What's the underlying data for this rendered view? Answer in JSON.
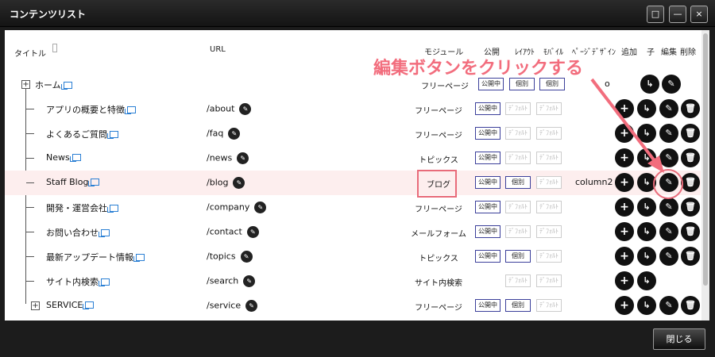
{
  "window": {
    "title": "コンテンツリスト",
    "maximize_icon": "□",
    "minimize_icon": "—",
    "close_icon": "×"
  },
  "headers": {
    "title": "タイトル",
    "url": "URL",
    "module": "モジュール",
    "publish": "公開",
    "layout": "ﾚｲｱｳﾄ",
    "mobile": "ﾓﾊﾞｲﾙ",
    "page_design": "ﾍﾟｰｼﾞﾃﾞｻﾞｲﾝ",
    "add": "追加",
    "child": "子",
    "edit": "編集",
    "delete": "削除"
  },
  "annotation": "編集ボタンをクリックする",
  "rows": [
    {
      "name": "ホーム",
      "url": "",
      "module": "フリーページ",
      "publish": "公開中",
      "layout": "個別",
      "mobile": "個別",
      "page_design": "o"
    },
    {
      "name": "アプリの概要と特徴",
      "url": "/about",
      "module": "フリーページ",
      "publish": "公開中",
      "layout": "ﾃﾞﾌｫﾙﾄ",
      "mobile": "ﾃﾞﾌｫﾙﾄ",
      "page_design": ""
    },
    {
      "name": "よくあるご質問",
      "url": "/faq",
      "module": "フリーページ",
      "publish": "公開中",
      "layout": "ﾃﾞﾌｫﾙﾄ",
      "mobile": "ﾃﾞﾌｫﾙﾄ",
      "page_design": ""
    },
    {
      "name": "News",
      "url": "/news",
      "module": "トピックス",
      "publish": "公開中",
      "layout": "ﾃﾞﾌｫﾙﾄ",
      "mobile": "ﾃﾞﾌｫﾙﾄ",
      "page_design": ""
    },
    {
      "name": "Staff Blog",
      "url": "/blog",
      "module": "ブログ",
      "publish": "公開中",
      "layout": "個別",
      "mobile": "ﾃﾞﾌｫﾙﾄ",
      "page_design": "column2"
    },
    {
      "name": "開発・運営会社",
      "url": "/company",
      "module": "フリーページ",
      "publish": "公開中",
      "layout": "ﾃﾞﾌｫﾙﾄ",
      "mobile": "ﾃﾞﾌｫﾙﾄ",
      "page_design": ""
    },
    {
      "name": "お問い合わせ",
      "url": "/contact",
      "module": "メールフォーム",
      "publish": "公開中",
      "layout": "ﾃﾞﾌｫﾙﾄ",
      "mobile": "ﾃﾞﾌｫﾙﾄ",
      "page_design": ""
    },
    {
      "name": "最新アップデート情報",
      "url": "/topics",
      "module": "トピックス",
      "publish": "公開中",
      "layout": "個別",
      "mobile": "ﾃﾞﾌｫﾙﾄ",
      "page_design": ""
    },
    {
      "name": "サイト内検索",
      "url": "/search",
      "module": "サイト内検索",
      "publish": "",
      "layout": "ﾃﾞﾌｫﾙﾄ",
      "mobile": "ﾃﾞﾌｫﾙﾄ",
      "page_design": ""
    },
    {
      "name": "SERVICE",
      "url": "/service",
      "module": "フリーページ",
      "publish": "公開中",
      "layout": "個別",
      "mobile": "ﾃﾞﾌｫﾙﾄ",
      "page_design": ""
    }
  ],
  "footer": {
    "close_label": "閉じる"
  },
  "colors": {
    "accent": "#f26d7d",
    "tag_border": "#3b3f9a",
    "link_icon": "#2a7fd4"
  }
}
